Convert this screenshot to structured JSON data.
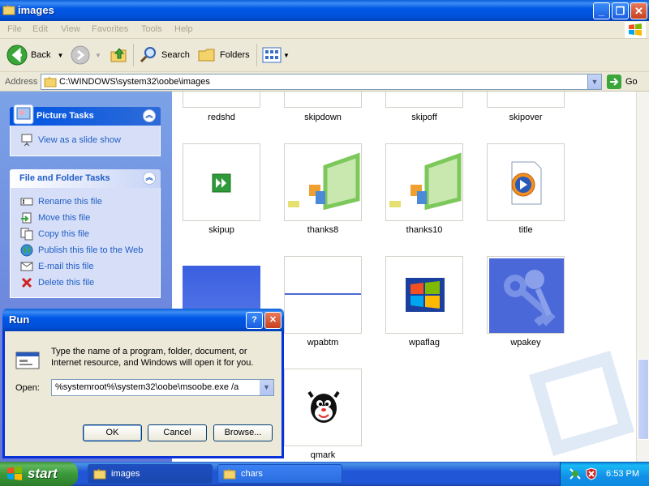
{
  "window": {
    "title": "images",
    "controls": [
      "minimize",
      "maximize",
      "close"
    ]
  },
  "menu": [
    "File",
    "Edit",
    "View",
    "Favorites",
    "Tools",
    "Help"
  ],
  "toolbar": {
    "back_label": "Back",
    "search_label": "Search",
    "folders_label": "Folders"
  },
  "address": {
    "label": "Address",
    "value": "C:\\WINDOWS\\system32\\oobe\\images",
    "go_label": "Go"
  },
  "task_pane": {
    "picture_tasks": {
      "title": "Picture Tasks",
      "items": [
        "View as a slide show"
      ]
    },
    "file_folder_tasks": {
      "title": "File and Folder Tasks",
      "items": [
        "Rename this file",
        "Move this file",
        "Copy this file",
        "Publish this file to the Web",
        "E-mail this file",
        "Delete this file"
      ]
    }
  },
  "files": [
    {
      "name": "redshd"
    },
    {
      "name": "skipdown"
    },
    {
      "name": "skipoff"
    },
    {
      "name": "skipover"
    },
    {
      "name": "skipup"
    },
    {
      "name": "thanks8"
    },
    {
      "name": "thanks10"
    },
    {
      "name": "title"
    },
    {
      "name": ""
    },
    {
      "name": "wpabtm"
    },
    {
      "name": "wpaflag"
    },
    {
      "name": "wpakey"
    },
    {
      "name": "qmark"
    }
  ],
  "run_dialog": {
    "title": "Run",
    "description": "Type the name of a program, folder, document, or Internet resource, and Windows will open it for you.",
    "open_label": "Open:",
    "open_value": "%systemroot%\\system32\\oobe\\msoobe.exe /a",
    "ok_label": "OK",
    "cancel_label": "Cancel",
    "browse_label": "Browse..."
  },
  "taskbar": {
    "start_label": "start",
    "tasks": [
      "images",
      "chars"
    ],
    "clock": "6:53 PM"
  }
}
